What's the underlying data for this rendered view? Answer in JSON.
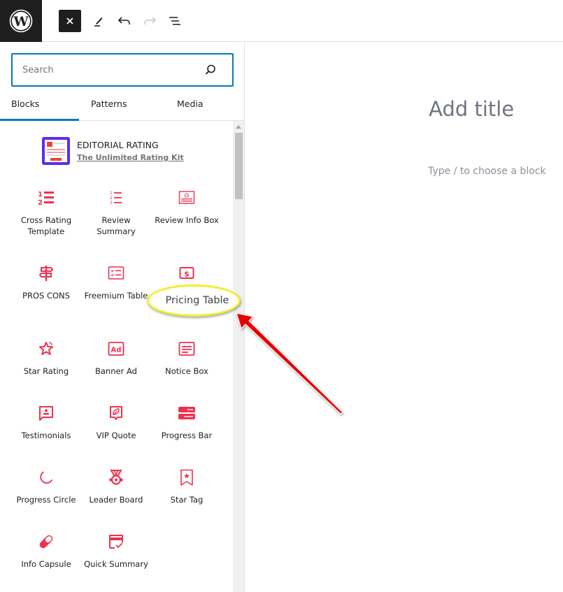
{
  "toolbar": {
    "logo": "wordpress-logo",
    "close_label": "×",
    "icons": [
      "close-icon",
      "pencil-icon",
      "undo-icon",
      "redo-icon",
      "document-overview-icon"
    ]
  },
  "inserter": {
    "search": {
      "value": "",
      "placeholder": "Search"
    },
    "tabs": [
      {
        "label": "Blocks",
        "active": true
      },
      {
        "label": "Patterns",
        "active": false
      },
      {
        "label": "Media",
        "active": false
      }
    ],
    "collection": {
      "title": "EDITORIAL RATING",
      "subtitle": "The Unlimited Rating Kit"
    },
    "blocks": [
      {
        "label": "Cross Rating Template",
        "icon": "numbered-list-icon"
      },
      {
        "label": "Review Summary",
        "icon": "ordered-list-icon"
      },
      {
        "label": "Review Info Box",
        "icon": "info-box-icon"
      },
      {
        "label": "PROS CONS",
        "icon": "signpost-icon"
      },
      {
        "label": "Freemium Table",
        "icon": "checklist-icon"
      },
      {
        "label": "Pricing Table",
        "icon": "dollar-icon"
      },
      {
        "label": "Star Rating",
        "icon": "star-icon"
      },
      {
        "label": "Banner Ad",
        "icon": "ad-icon"
      },
      {
        "label": "Notice Box",
        "icon": "notice-icon"
      },
      {
        "label": "Testimonials",
        "icon": "testimonial-icon"
      },
      {
        "label": "VIP Quote",
        "icon": "quote-leaf-icon"
      },
      {
        "label": "Progress Bar",
        "icon": "progress-bar-icon"
      },
      {
        "label": "Progress Circle",
        "icon": "progress-circle-icon"
      },
      {
        "label": "Leader Board",
        "icon": "medal-icon"
      },
      {
        "label": "Star Tag",
        "icon": "bookmark-star-icon"
      },
      {
        "label": "Info Capsule",
        "icon": "capsule-icon"
      },
      {
        "label": "Quick Summary",
        "icon": "card-check-icon"
      }
    ],
    "accent_color": "#f0304f"
  },
  "editor": {
    "title_placeholder": "Add title",
    "block_prompt": "Type / to choose a block"
  },
  "annotation": {
    "callout_text": "Pricing Table",
    "callout_border_color": "#f2ef2a",
    "arrow_color": "#e80000"
  }
}
